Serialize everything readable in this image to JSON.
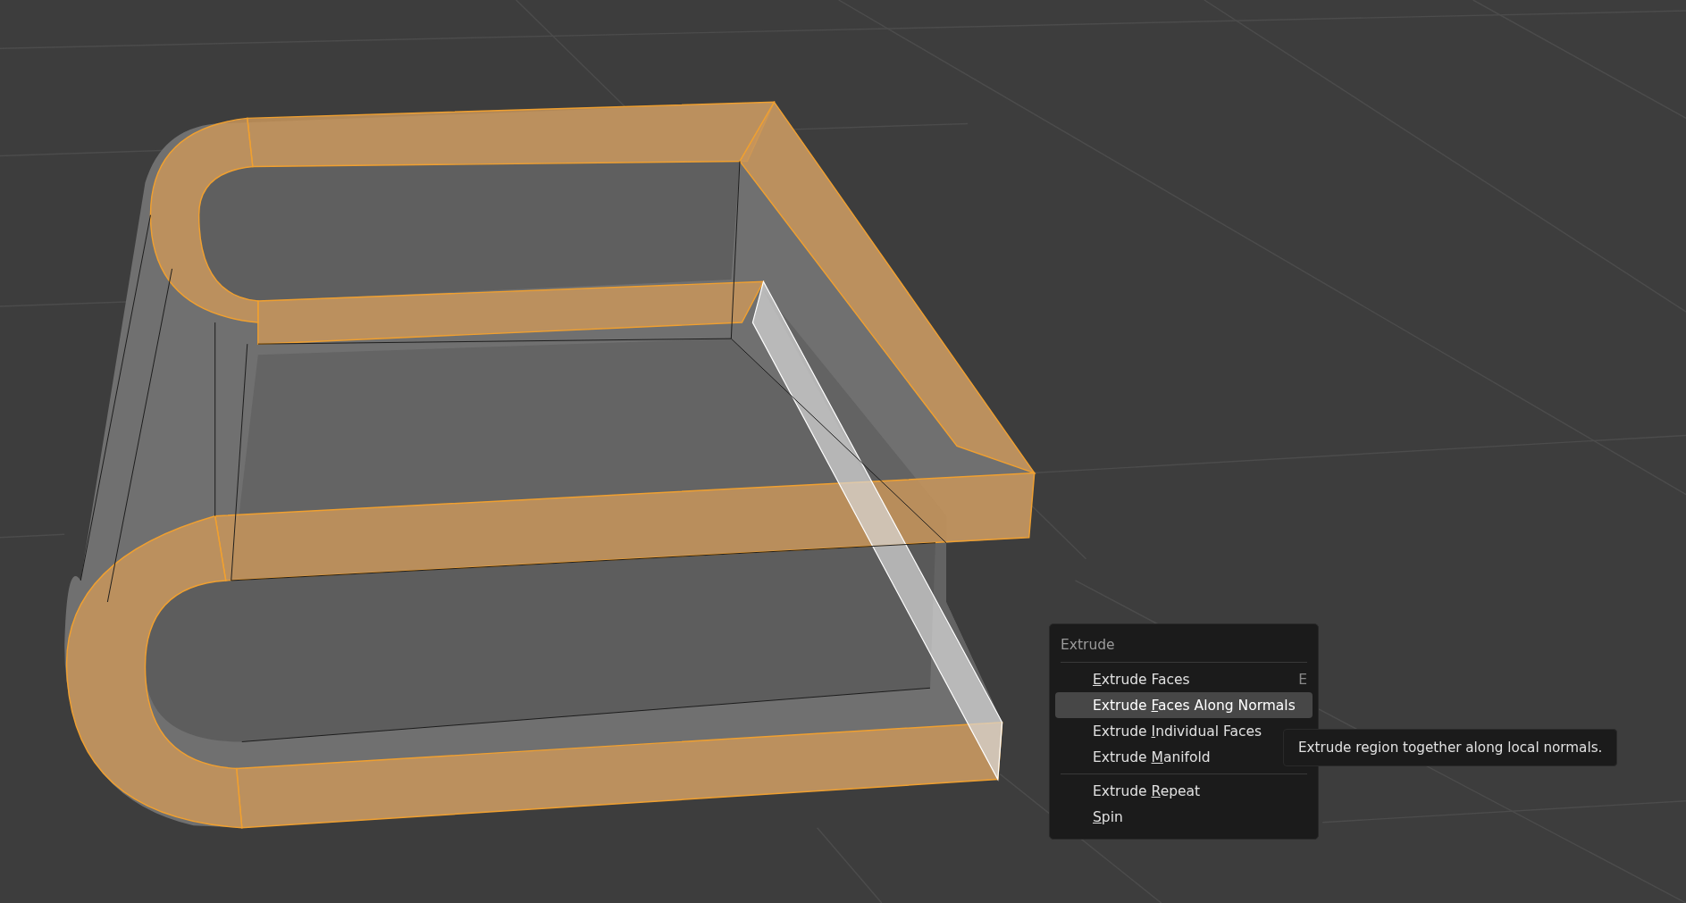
{
  "menu": {
    "title": "Extrude",
    "sections": [
      [
        {
          "key": "E",
          "post": "xtrude Faces",
          "shortcut": "E",
          "selected": false
        },
        {
          "pre": "Extrude ",
          "key": "F",
          "post": "aces Along Normals",
          "selected": true
        },
        {
          "pre": "Extrude ",
          "key": "I",
          "post": "ndividual Faces",
          "selected": false
        },
        {
          "pre": "Extrude ",
          "key": "M",
          "post": "anifold",
          "selected": false
        }
      ],
      [
        {
          "pre": "Extrude ",
          "key": "R",
          "post": "epeat",
          "selected": false
        },
        {
          "key": "S",
          "post": "pin",
          "selected": false
        }
      ]
    ]
  },
  "tooltip": {
    "text": "Extrude region together along local normals."
  }
}
